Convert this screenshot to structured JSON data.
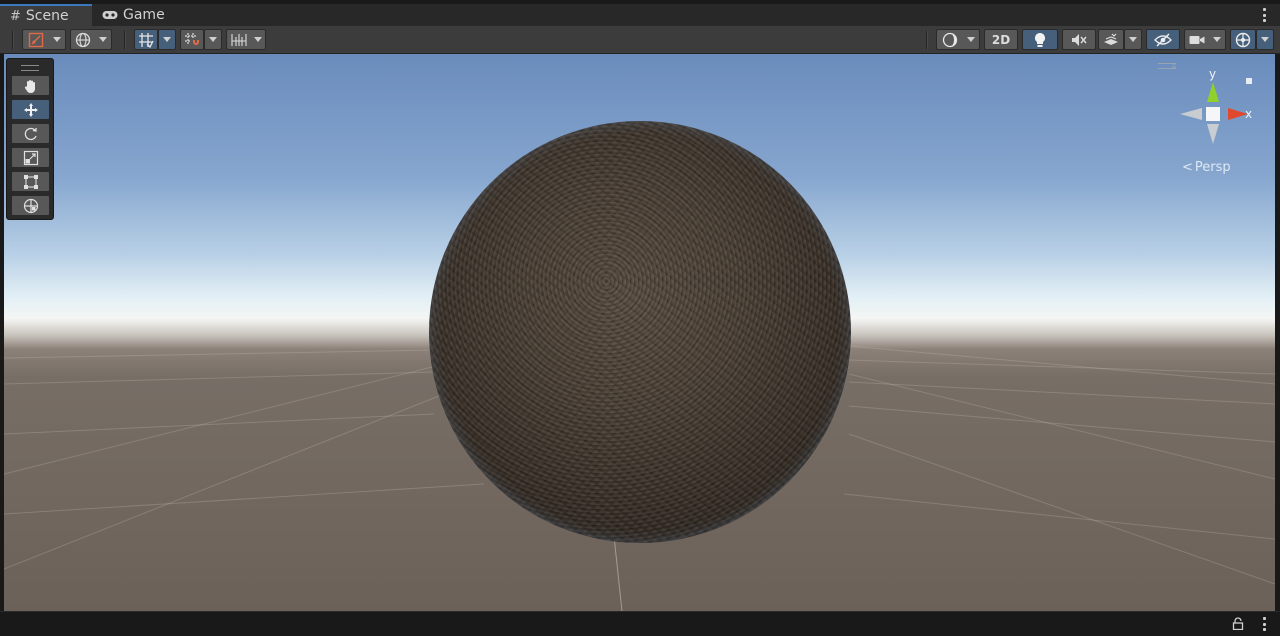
{
  "tabs": [
    {
      "label": "Scene",
      "icon": "grid-hash-icon",
      "active": true
    },
    {
      "label": "Game",
      "icon": "gamepad-icon",
      "active": false
    }
  ],
  "toolbar": {
    "view_2d_label": "2D",
    "accent_color": "#46607c"
  },
  "tools": [
    {
      "name": "hand-tool",
      "icon": "hand-icon",
      "active": false
    },
    {
      "name": "move-tool",
      "icon": "move-arrows-icon",
      "active": true
    },
    {
      "name": "rotate-tool",
      "icon": "rotate-icon",
      "active": false
    },
    {
      "name": "scale-tool",
      "icon": "scale-icon",
      "active": false
    },
    {
      "name": "rect-tool",
      "icon": "rect-transform-icon",
      "active": false
    },
    {
      "name": "transform-tool",
      "icon": "transform-icon",
      "active": false
    }
  ],
  "gizmo": {
    "y_label": "y",
    "x_label": "x",
    "projection_label": "Persp",
    "x_color": "#e0492e",
    "y_color": "#8fd12a"
  }
}
